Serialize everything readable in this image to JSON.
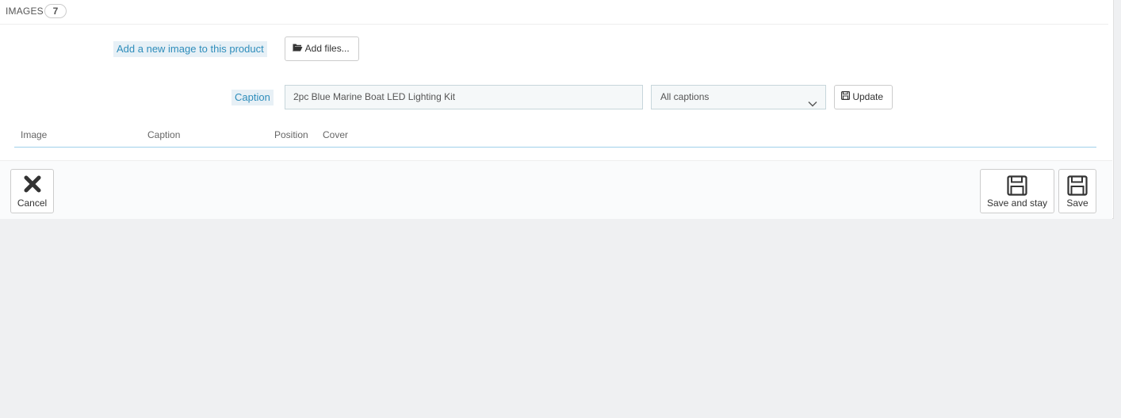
{
  "heading": {
    "title": "IMAGES",
    "count": "7"
  },
  "upload": {
    "label": "Add a new image to this product",
    "button": "Add files..."
  },
  "caption": {
    "label": "Caption",
    "value": "2pc Blue Marine Boat LED Lighting Kit",
    "select_value": "All captions",
    "update_button": "Update"
  },
  "table": {
    "columns": [
      "Image",
      "Caption",
      "Position",
      "Cover"
    ]
  },
  "footer": {
    "cancel": "Cancel",
    "save_and_stay": "Save and stay",
    "save": "Save"
  },
  "icons": {
    "folder": "folder-open-icon",
    "floppy": "floppy-icon",
    "close": "close-icon",
    "chevron": "chevron-down-icon"
  }
}
